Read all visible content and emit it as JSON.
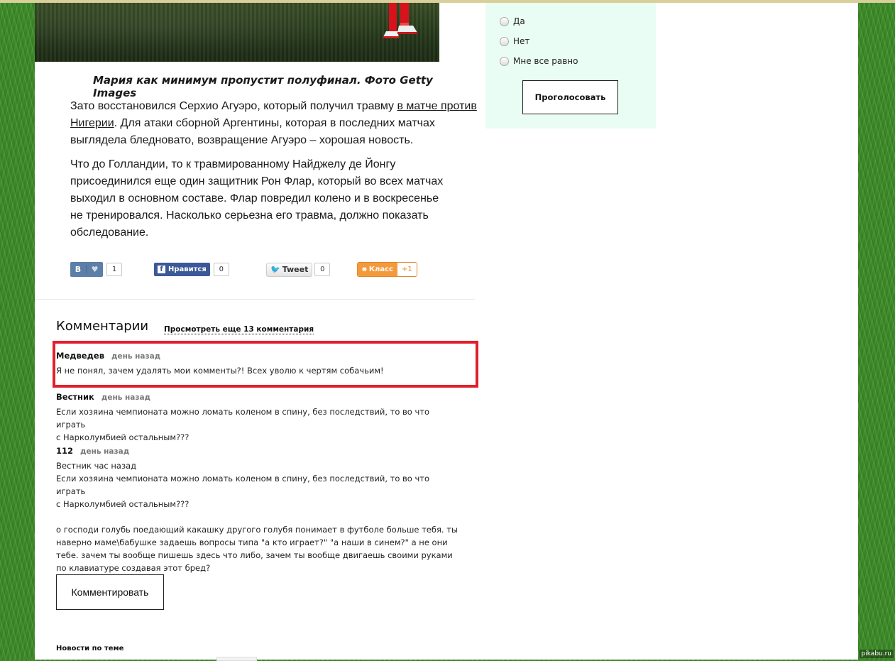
{
  "article": {
    "caption": "Мария как минимум пропустит полуфинал. Фото Getty Images",
    "para1_before": "Зато восстановился Серхио Агуэро, который получил травму ",
    "para1_link": "в матче против Нигерии",
    "para1_after": ". Для атаки сборной Аргентины, которая в последних матчах выглядела бледновато, возвращение Агуэро – хорошая новость.",
    "para2": "Что до Голландии, то к травмированному Найджелу де Йонгу присоединился еще один защитник Рон Флар, который во всех матчах выходил в основном составе. Флар повредил колено и в воскресенье не тренировался. Насколько серьезна его травма, должно показать обследование."
  },
  "share": {
    "vk_label": "В",
    "vk_count": "1",
    "fb_label": "Нравится",
    "fb_count": "0",
    "tw_label": "Tweet",
    "tw_count": "0",
    "ok_label": "Класс",
    "ok_count": "+1"
  },
  "comments": {
    "title": "Комментарии",
    "more_link": "Просмотреть еще 13 комментария",
    "items": [
      {
        "author": "Медведев",
        "time": "день назад",
        "text": "Я не понял, зачем удалять мои комменты?! Всех уволю к чертям собачьим!"
      },
      {
        "author": "Вестник",
        "time": "день назад",
        "text": "Если хозяина чемпионата можно ломать коленом в спину, без последствий,  то во что играть\nс Нарколумбией остальным???"
      },
      {
        "author": "112",
        "time": "день назад",
        "text": "Вестник час назад\nЕсли хозяина чемпионата можно ломать коленом в спину, без последствий,  то во что играть\nс Нарколумбией остальным???\n\nо господи голубь поедающий какашку другого голубя понимает в футболе больше тебя. ты\nнаверно маме\\бабушке задаешь вопросы типа \"а кто играет?\"  \"а наши в синем?\" а не они\nтебе. зачем ты вообще пишешь здесь что либо, зачем ты вообще двигаешь своими руками\nпо клавиатуре создавая этот бред?"
      }
    ],
    "comment_button": "Комментировать"
  },
  "news_heading": "Новости по теме",
  "poll": {
    "options": [
      "Да",
      "Нет",
      "Мне все равно"
    ],
    "vote_button": "Проголосовать"
  },
  "watermark": "pikabu.ru",
  "colors": {
    "highlight": "#e0202c",
    "poll_bg": "#e9fdf4",
    "grass": "#3f8f2a"
  }
}
